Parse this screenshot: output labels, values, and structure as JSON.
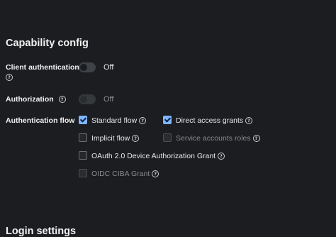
{
  "section": {
    "title": "Capability config"
  },
  "client_auth": {
    "label": "Client authentication",
    "state": "Off",
    "on": false
  },
  "authorization": {
    "label": "Authorization",
    "state": "Off",
    "on": false,
    "disabled": true
  },
  "auth_flow": {
    "label": "Authentication flow",
    "options": {
      "standard": {
        "label": "Standard flow",
        "checked": true
      },
      "direct": {
        "label": "Direct access grants",
        "checked": true
      },
      "implicit": {
        "label": "Implicit flow",
        "checked": false
      },
      "service": {
        "label": "Service accounts roles",
        "checked": false,
        "disabled": true
      },
      "device": {
        "label": "OAuth 2.0 Device Authorization Grant",
        "checked": false
      },
      "ciba": {
        "label": "OIDC CIBA Grant",
        "checked": false,
        "disabled": true
      }
    }
  },
  "next_section": {
    "title": "Login settings"
  },
  "colors": {
    "background": "#1b1d21",
    "accent": "#7fb7ff",
    "text": "#e8e8e8",
    "muted": "#8a8a8a"
  },
  "icons": {
    "help": "question-circle-icon"
  }
}
